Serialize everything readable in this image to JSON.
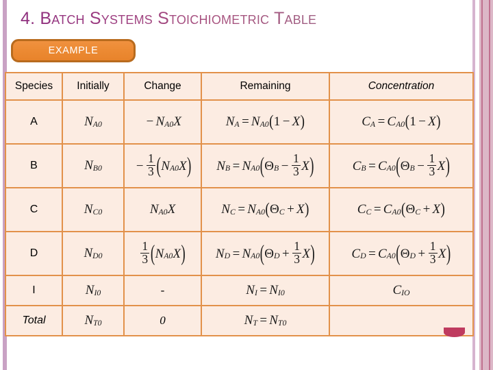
{
  "slide": {
    "title": "4. Batch Systems Stoichiometric Table",
    "example_button": "EXAMPLE",
    "accent_orange": "#e8832b",
    "accent_border": "#b86b1e",
    "table_border": "#e2914a",
    "table_cell_bg": "#fcece2",
    "title_color_start": "#8e2f7e",
    "title_color_end": "#8c6b84",
    "ornament_color": "#bf3b5f",
    "edge_color": "#c9a2c4"
  },
  "table": {
    "headers": {
      "species": "Species",
      "initially": "Initially",
      "change": "Change",
      "remaining": "Remaining",
      "concentration": "Concentration"
    },
    "rows": [
      {
        "species": "A",
        "initially": "N_A0",
        "change": "-N_A0 X",
        "remaining": "N_A = N_A0 (1 - X)",
        "concentration": "C_A = C_A0 (1 - X)"
      },
      {
        "species": "B",
        "initially": "N_B0",
        "change": "-(1/3)(N_A0 X)",
        "remaining": "N_B = N_A0 (Theta_B - (1/3) X)",
        "concentration": "C_B = C_A0 (Theta_B - (1/3) X)"
      },
      {
        "species": "C",
        "initially": "N_C0",
        "change": "N_A0 X",
        "remaining": "N_C = N_A0 (Theta_C + X)",
        "concentration": "C_C = C_A0 (Theta_C + X)"
      },
      {
        "species": "D",
        "initially": "N_D0",
        "change": "(1/3)(N_A0 X)",
        "remaining": "N_D = N_A0 (Theta_D + (1/3) X)",
        "concentration": "C_D = C_A0 (Theta_D + (1/3) X)"
      },
      {
        "species": "I",
        "initially": "N_I0",
        "change": "-",
        "remaining": "N_I = N_I0",
        "concentration": "C_IO"
      },
      {
        "species": "Total",
        "initially": "N_T0",
        "change": "0",
        "remaining": "N_T = N_T0",
        "concentration": ""
      }
    ],
    "symbols": {
      "N": "N",
      "C": "C",
      "X": "X",
      "theta": "Θ",
      "minus": "−",
      "plus": "+",
      "equals": "=",
      "one": "1",
      "three": "3",
      "zero": "0",
      "dash": "-",
      "sub_A0": "A0",
      "sub_B0": "B0",
      "sub_C0": "C0",
      "sub_D0": "D0",
      "sub_I0": "I0",
      "sub_T0": "T0",
      "sub_A": "A",
      "sub_B": "B",
      "sub_C": "C",
      "sub_D": "D",
      "sub_I": "I",
      "sub_T": "T",
      "sub_IO": "IO",
      "lparen": "(",
      "rparen": ")"
    }
  }
}
